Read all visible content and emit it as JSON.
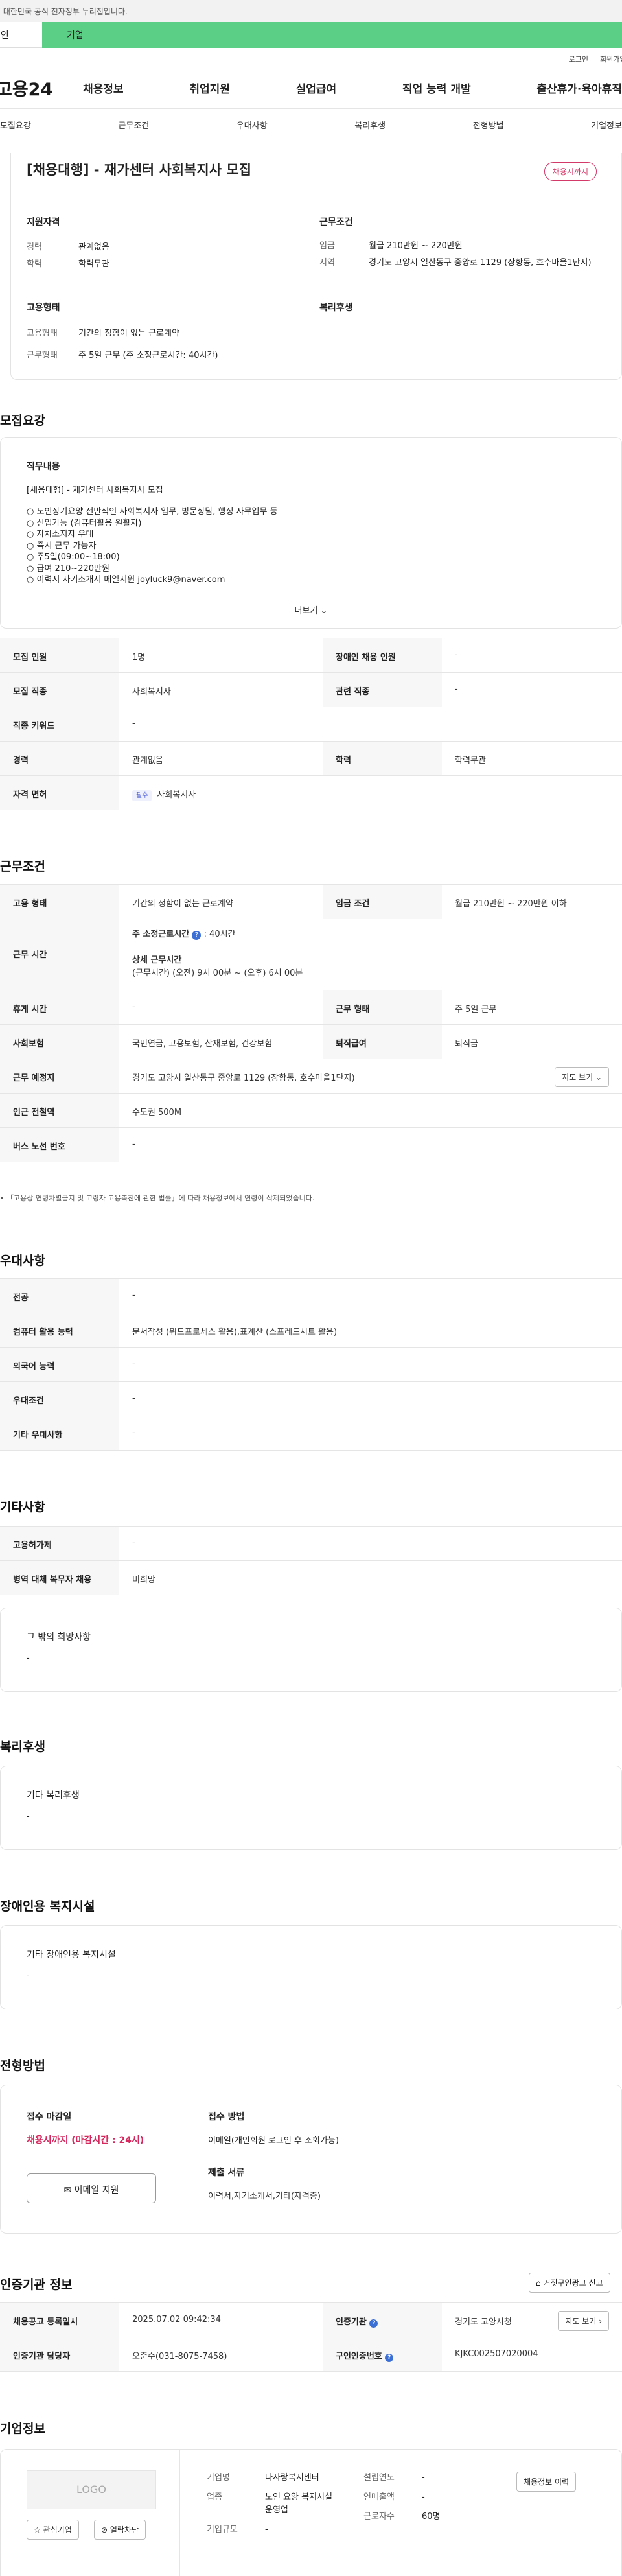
{
  "gov_banner": "이 누리집은 대한민국 공식 전자정부 누리집입니다.",
  "top_tabs": {
    "personal": "개인",
    "company": "기업"
  },
  "util_links": [
    "로그인",
    "회원가입"
  ],
  "logo": "고용24",
  "main_nav": [
    "채용정보",
    "취업지원",
    "실업급여",
    "직업 능력 개발",
    "출산휴가·육아휴직"
  ],
  "sub_tabs": [
    "모집요강",
    "근무조건",
    "우대사항",
    "복리후생",
    "전형방법",
    "기업정보"
  ],
  "summary": {
    "title": "[채용대행] - 재가센터 사회복지사 모집",
    "badge": "채용시까지",
    "qual_heading": "지원자격",
    "career_label": "경력",
    "career_value": "관계없음",
    "edu_label": "학력",
    "edu_value": "학력무관",
    "cond_heading": "근무조건",
    "wage_label": "임금",
    "wage_value": "월급 210만원 ~ 220만원",
    "region_label": "지역",
    "region_value": "경기도 고양시 일산동구 중앙로 1129 (장항동, 호수마을1단지)",
    "emp_heading": "고용형태",
    "emp_label": "고용형태",
    "emp_value": "기간의 정함이 없는 근로계약",
    "worktype_label": "근무형태",
    "worktype_value": "주 5일 근무 (주 소정근로시간: 40시간)",
    "welfare_heading": "복리후생"
  },
  "recruit": {
    "heading": "모집요강",
    "duty_heading": "직무내용",
    "duty_title": "[채용대행] - 재가센터 사회복지사 모집",
    "duty_lines": [
      "노인장기요양 전반적인 사회복지사 업무, 방문상담, 행정 사무업무 등",
      "신입가능 (컴퓨터활용 원활자)",
      "자차소지자 우대",
      "즉시 근무 가능자",
      "주5일(09:00~18:00)",
      "급여 210~220만원",
      "이력서 자기소개서 메일지원 joyluck9@naver.com"
    ],
    "more": "더보기",
    "people_label": "모집 인원",
    "people_value": "1명",
    "disabled_label": "장애인 채용 인원",
    "disabled_value": "-",
    "job_label": "모집 직종",
    "job_value": "사회복지사",
    "related_label": "관련 직종",
    "related_value": "-",
    "keyword_label": "직종 키워드",
    "keyword_value": "-",
    "career_label": "경력",
    "career_value": "관계없음",
    "edu_label": "학력",
    "edu_value": "학력무관",
    "license_label": "자격 면허",
    "license_tag": "필수",
    "license_value": "사회복지사"
  },
  "conditions": {
    "heading": "근무조건",
    "emp_label": "고용 형태",
    "emp_value": "기간의 정함이 없는 근로계약",
    "wage_label": "임금 조건",
    "wage_value": "월급 210만원 ~ 220만원 이하",
    "hours_label": "근무 시간",
    "hours_main": "주 소정근로시간",
    "hours_main_value": ": 40시간",
    "hours_detail_title": "상세 근무시간",
    "hours_detail": "(근무시간) (오전) 9시 00분 ~ (오후) 6시 00분",
    "rest_label": "휴게 시간",
    "rest_value": "-",
    "worktype_label": "근무 형태",
    "worktype_value": "주 5일 근무",
    "insurance_label": "사회보험",
    "insurance_value": "국민연금, 고용보험, 산재보험, 건강보험",
    "severance_label": "퇴직급여",
    "severance_value": "퇴직금",
    "place_label": "근무 예정지",
    "place_value": "경기도 고양시 일산동구 중앙로 1129 (장항동, 호수마을1단지)",
    "map_button": "지도 보기",
    "subway_label": "인근 전철역",
    "subway_value": "수도권 500M",
    "bus_label": "버스 노선 번호",
    "bus_value": "-",
    "notice": "「고용상 연령차별금지 및 고령자 고용촉진에 관한 법률」에 따라 채용정보에서 연령이 삭제되었습니다."
  },
  "preference": {
    "heading": "우대사항",
    "major_label": "전공",
    "major_value": "-",
    "computer_label": "컴퓨터 활용 능력",
    "computer_value": "문서작성 (워드프로세스 활용),표계산 (스프레드시트 활용)",
    "lang_label": "외국어 능력",
    "lang_value": "-",
    "cond_label": "우대조건",
    "cond_value": "-",
    "etc_label": "기타 우대사항",
    "etc_value": "-"
  },
  "etc": {
    "heading": "기타사항",
    "ins_label": "고용허가제",
    "ins_value": "-",
    "military_label": "병역 대체 복무자 채용",
    "military_value": "비희망",
    "hope_title": "그 밖의 희망사항",
    "hope_value": "-"
  },
  "welfare": {
    "heading": "복리후생",
    "title": "기타 복리후생",
    "value": "-"
  },
  "disability": {
    "heading": "장애인용 복지시설",
    "title": "기타 장애인용 복지시설",
    "value": "-"
  },
  "process": {
    "heading": "전형방법",
    "deadline_title": "접수 마감일",
    "deadline_value": "채용시까지 (마감시간 : 24시)",
    "apply_button": "이메일 지원",
    "method_title": "접수 방법",
    "method_value": "이메일(개인회원 로그인 후 조회가능)",
    "docs_title": "제출 서류",
    "docs_value": "이력서,자기소개서,기타(자격증)"
  },
  "agency": {
    "heading": "인증기관 정보",
    "report_button": "거짓구인광고 신고",
    "reg_label": "채용공고 등록일시",
    "reg_value": "2025.07.02 09:42:34",
    "cert_label": "인증기관",
    "cert_value": "경기도 고양시청",
    "map_button": "지도 보기",
    "manager_label": "인증기관 담당자",
    "manager_value": "오준수(031-8075-7458)",
    "jobno_label": "구인인증번호",
    "jobno_value": "KJKC002507020004"
  },
  "company": {
    "heading": "기업정보",
    "logo_text": "LOGO",
    "interest_button": "관심기업",
    "block_button": "열람차단",
    "name_label": "기업명",
    "name_value": "다사랑복지센터",
    "industry_label": "업종",
    "industry_value": "노인 요양 복지시설 운영업",
    "size_label": "기업규모",
    "size_value": "-",
    "year_label": "설립연도",
    "year_value": "-",
    "sales_label": "연매출액",
    "sales_value": "-",
    "staff_label": "근로자수",
    "staff_value": "60명",
    "history_button": "채용정보 이력"
  }
}
